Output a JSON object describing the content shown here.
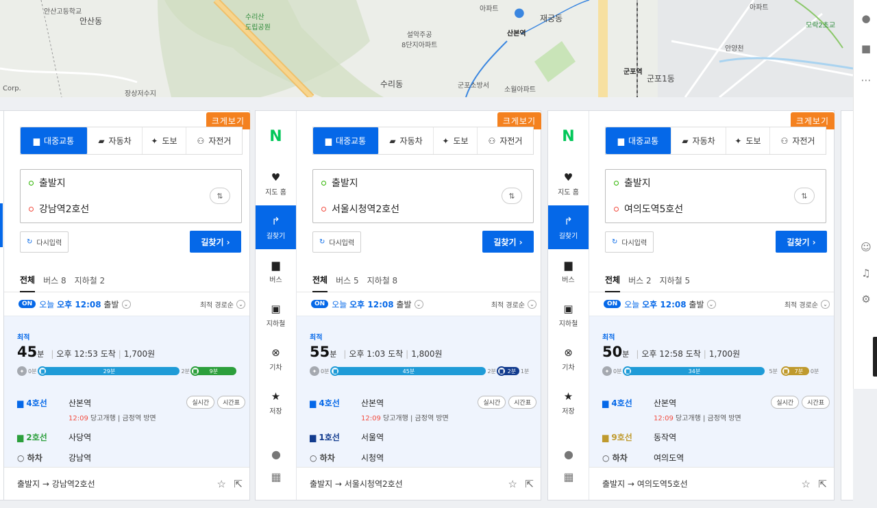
{
  "map": {
    "labels": [
      "안산고등학교",
      "안산동",
      "수리산\n도립공원",
      "설악주공\n8단지아파트",
      "산본역",
      "재궁동",
      "수리동",
      "군포소방서",
      "소월아파트",
      "안양천",
      "군포역",
      "군포1동",
      "장상저수지",
      "Corp.",
      "아파트",
      "모락2초교",
      "아파트"
    ]
  },
  "panels": [
    {
      "zoom_label": "크게보기",
      "modes": [
        "대중교통",
        "자동차",
        "도보",
        "자전거"
      ],
      "origin": "출발지",
      "destination": "강남역2호선",
      "reset": "다시입력",
      "search": "길찾기 ›",
      "tabs": [
        "전체",
        "버스 8",
        "지하철 2"
      ],
      "on": "ON",
      "today": "오늘",
      "time": "오후 12:08",
      "depart": "출발",
      "sort": "최적 경로순",
      "best": "최적",
      "minutes": "45",
      "min_unit": "분",
      "arrive": "오후 12:53 도착",
      "fare": "1,700원",
      "walk1": "0분",
      "seg1": "29분",
      "gap": "2분",
      "seg2": "9분",
      "walk2": "",
      "step1_line": "4호선",
      "step1_station": "산본역",
      "step1_time": "12:09",
      "step1_info": "당고개행 | 금정역 방면",
      "realtime": "실시간",
      "timetable": "시간표",
      "step2_line": "2호선",
      "step2_station": "사당역",
      "step3_line": "하차",
      "step3_station": "강남역",
      "footer": "출발지 → 강남역2호선"
    },
    {
      "zoom_label": "크게보기",
      "modes": [
        "대중교통",
        "자동차",
        "도보",
        "자전거"
      ],
      "origin": "출발지",
      "destination": "서울시청역2호선",
      "reset": "다시입력",
      "search": "길찾기 ›",
      "tabs": [
        "전체",
        "버스 5",
        "지하철 8"
      ],
      "on": "ON",
      "today": "오늘",
      "time": "오후 12:08",
      "depart": "출발",
      "sort": "최적 경로순",
      "best": "최적",
      "minutes": "55",
      "min_unit": "분",
      "arrive": "오후 1:03 도착",
      "fare": "1,800원",
      "walk1": "0분",
      "seg1": "45분",
      "gap": "2분",
      "seg2": "2분",
      "walk2": "1분",
      "step1_line": "4호선",
      "step1_station": "산본역",
      "step1_time": "12:09",
      "step1_info": "당고개행 | 금정역 방면",
      "realtime": "실시간",
      "timetable": "시간표",
      "step2_line": "1호선",
      "step2_station": "서울역",
      "step3_line": "하차",
      "step3_station": "시청역",
      "footer": "출발지 → 서울시청역2호선"
    },
    {
      "zoom_label": "크게보기",
      "modes": [
        "대중교통",
        "자동차",
        "도보",
        "자전거"
      ],
      "origin": "출발지",
      "destination": "여의도역5호선",
      "reset": "다시입력",
      "search": "길찾기 ›",
      "tabs": [
        "전체",
        "버스 2",
        "지하철 5"
      ],
      "on": "ON",
      "today": "오늘",
      "time": "오후 12:08",
      "depart": "출발",
      "sort": "최적 경로순",
      "best": "최적",
      "minutes": "50",
      "min_unit": "분",
      "arrive": "오후 12:58 도착",
      "fare": "1,700원",
      "walk1": "0분",
      "seg1": "34분",
      "gap": "5분",
      "seg2": "7분",
      "walk2": "0분",
      "step1_line": "4호선",
      "step1_station": "산본역",
      "step1_time": "12:09",
      "step1_info": "당고개행 | 금정역 방면",
      "realtime": "실시간",
      "timetable": "시간표",
      "step2_line": "9호선",
      "step2_station": "동작역",
      "step3_line": "하차",
      "step3_station": "여의도역",
      "footer": "출발지 → 여의도역5호선"
    }
  ],
  "nav": {
    "logo": "N",
    "items": [
      "지도 홈",
      "길찾기",
      "버스",
      "지하철",
      "기차",
      "저장"
    ]
  },
  "colors": {
    "accent": "#0568e8",
    "line4": "#1f9bd7",
    "line2": "#2c9f3c",
    "line1": "#123b8e",
    "line9": "#bf9a2e",
    "orange": "#f4811f"
  }
}
